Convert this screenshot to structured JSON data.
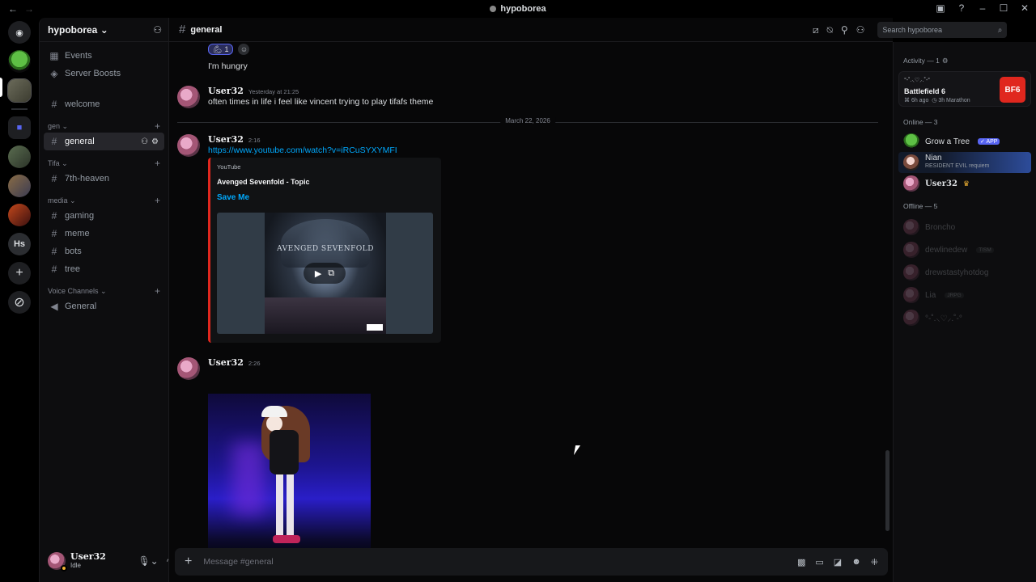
{
  "window": {
    "title": "hypoborea"
  },
  "server": {
    "name": "hypoborea"
  },
  "sidebar": {
    "top": [
      {
        "label": "Events"
      },
      {
        "label": "Server Boosts"
      }
    ],
    "welcome": "welcome",
    "categories": [
      {
        "name": "gen",
        "channels": [
          {
            "label": "general",
            "active": true
          }
        ]
      },
      {
        "name": "Tifa",
        "channels": [
          {
            "label": "7th-heaven"
          }
        ]
      },
      {
        "name": "media",
        "channels": [
          {
            "label": "gaming"
          },
          {
            "label": "meme"
          },
          {
            "label": "bots"
          },
          {
            "label": "tree"
          }
        ]
      },
      {
        "name": "Voice Channels",
        "channels": [
          {
            "label": "General"
          }
        ]
      }
    ],
    "rail_hs": "Hs"
  },
  "user_panel": {
    "name": "User32",
    "status": "Idle"
  },
  "channel": {
    "name": "general"
  },
  "search": {
    "placeholder": "Search hypoborea"
  },
  "messages": {
    "reaction_count": "1",
    "prev_line": "I'm hungry",
    "m1": {
      "author": "User32",
      "time": "Yesterday at 21:25",
      "text": "often times in life i feel like vincent trying to play tifafs theme"
    },
    "date_divider": "March 22, 2026",
    "m2": {
      "author": "User32",
      "time": "2:16",
      "link": "https://www.youtube.com/watch?v=iRCuSYXYMFI",
      "embed": {
        "provider": "YouTube",
        "author": "Avenged Sevenfold - Topic",
        "title": "Save Me",
        "cover_text": "AVENGED SEVENFOLD"
      }
    },
    "m3": {
      "author": "User32",
      "time": "2:26"
    }
  },
  "composer": {
    "placeholder": "Message #general"
  },
  "members": {
    "activity_header": "Activity — 1",
    "activity": {
      "user": "°-˚.⸜♡⸝.˚-°",
      "game": "Battlefield 6",
      "ago": "6h ago",
      "mode": "3h Marathon",
      "badge": "BF6"
    },
    "online_header": "Online — 3",
    "online": [
      {
        "name": "Grow a Tree",
        "badge": "✓ APP"
      },
      {
        "name": "Nian",
        "sub": "RESIDENT EVIL requiem"
      },
      {
        "name": "User32"
      }
    ],
    "offline_header": "Offline — 5",
    "offline": [
      {
        "name": "Broncho"
      },
      {
        "name": "dewlinedew",
        "tag": "TISM"
      },
      {
        "name": "drewstastyhotdog"
      },
      {
        "name": "Lia",
        "tag": "JRPG"
      },
      {
        "name": "°-˚.⸜♡⸝.˚-°"
      }
    ]
  },
  "colors": {
    "accent": "#5865f2",
    "link": "#00a8fc",
    "youtube": "#e0271e",
    "idle": "#f0b232"
  }
}
